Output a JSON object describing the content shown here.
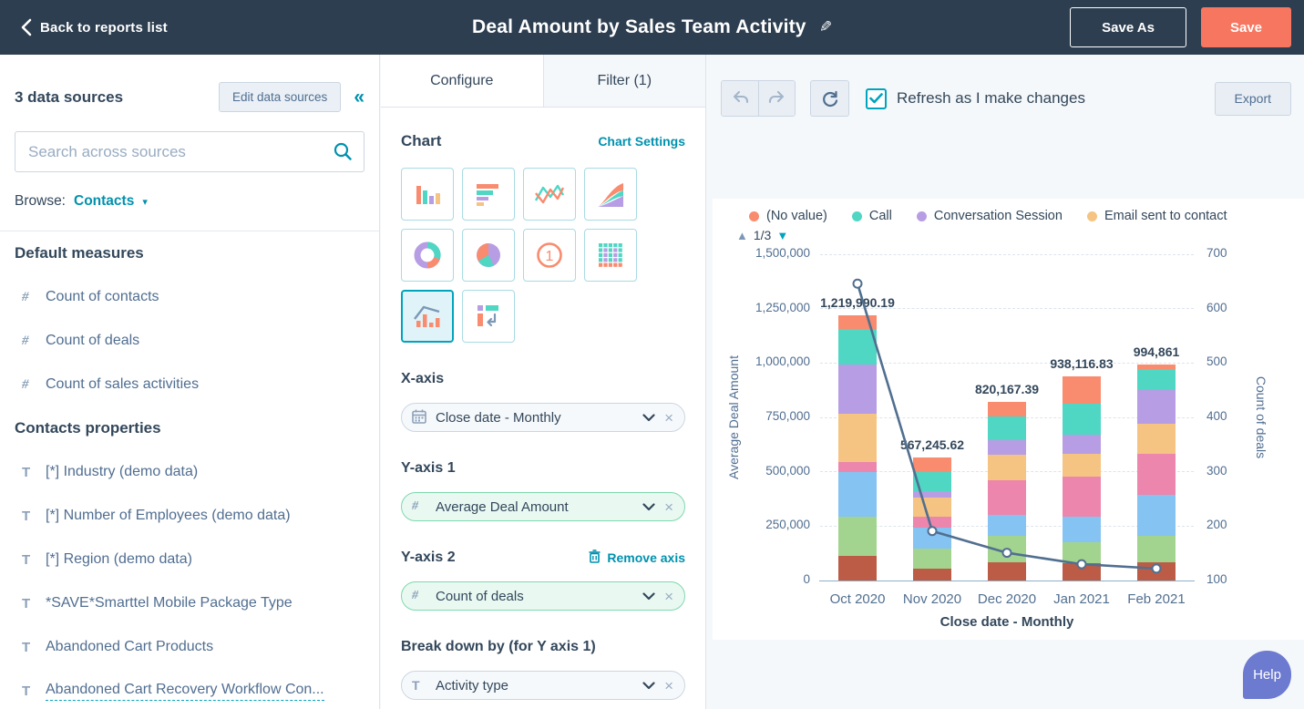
{
  "header": {
    "back_label": "Back to reports list",
    "title": "Deal Amount by Sales Team Activity",
    "save_as_label": "Save As",
    "save_label": "Save"
  },
  "sidebar": {
    "heading": "3 data sources",
    "edit_button": "Edit data sources",
    "collapse_icon": "double-chevron-left",
    "search_placeholder": "Search across sources",
    "browse_label": "Browse:",
    "browse_value": "Contacts",
    "sections": [
      {
        "title": "Default measures",
        "items": [
          {
            "icon": "#",
            "label": "Count of contacts"
          },
          {
            "icon": "#",
            "label": "Count of deals"
          },
          {
            "icon": "#",
            "label": "Count of sales activities"
          }
        ]
      },
      {
        "title": "Contacts properties",
        "items": [
          {
            "icon": "T",
            "label": "[*] Industry (demo data)"
          },
          {
            "icon": "T",
            "label": "[*] Number of Employees (demo data)"
          },
          {
            "icon": "T",
            "label": "[*] Region (demo data)"
          },
          {
            "icon": "T",
            "label": "*SAVE*Smarttel Mobile Package Type"
          },
          {
            "icon": "T",
            "label": "Abandoned Cart Products"
          },
          {
            "icon": "T",
            "label": "Abandoned Cart Recovery Workflow Con...",
            "truncated": true
          }
        ]
      }
    ]
  },
  "configure": {
    "tabs": [
      {
        "label": "Configure",
        "active": true
      },
      {
        "label": "Filter (1)",
        "active": false
      }
    ],
    "chart_heading": "Chart",
    "chart_settings_link": "Chart Settings",
    "chart_types": [
      "column",
      "bar",
      "line",
      "area",
      "donut",
      "pie",
      "summary",
      "table",
      "combo",
      "pivot"
    ],
    "selected_chart_type": "combo",
    "x_axis": {
      "label": "X-axis",
      "pill_icon": "calendar-icon",
      "pill_text": "Close date - Monthly"
    },
    "y_axis_1": {
      "label": "Y-axis 1",
      "pill_icon": "#",
      "pill_text": "Average Deal Amount"
    },
    "y_axis_2": {
      "label": "Y-axis 2",
      "remove_label": "Remove axis",
      "pill_icon": "#",
      "pill_text": "Count of deals"
    },
    "breakdown": {
      "label": "Break down by (for Y axis 1)",
      "pill_icon": "T",
      "pill_text": "Activity type"
    }
  },
  "preview": {
    "refresh_label": "Refresh as I make changes",
    "export_label": "Export",
    "pagination": "1/3",
    "pager_up_icon": "▲",
    "pager_down_icon": "▼",
    "help_label": "Help"
  },
  "chart_data": {
    "type": "combo: stacked column + line",
    "title": "",
    "categories": [
      "Oct 2020",
      "Nov 2020",
      "Dec 2020",
      "Jan 2021",
      "Feb 2021"
    ],
    "bar_series": [
      {
        "name": "",
        "color": "#bd5c46",
        "values": [
          113000,
          55000,
          82000,
          78000,
          82000
        ]
      },
      {
        "name": "",
        "color": "#a3d48f",
        "values": [
          182000,
          90000,
          122000,
          98000,
          122000
        ]
      },
      {
        "name": "",
        "color": "#84c3f2",
        "values": [
          202000,
          100000,
          98000,
          119000,
          188000
        ]
      },
      {
        "name": "",
        "color": "#ec86ad",
        "values": [
          49000,
          50000,
          160000,
          181000,
          189000
        ]
      },
      {
        "name": "Email sent to contact",
        "color": "#f5c482",
        "values": [
          221000,
          85000,
          115000,
          105000,
          140000
        ]
      },
      {
        "name": "Conversation Session",
        "color": "#b79de3",
        "values": [
          226000,
          30000,
          67000,
          91000,
          153000
        ]
      },
      {
        "name": "Call",
        "color": "#4fd7c4",
        "values": [
          163000,
          90000,
          109000,
          139000,
          97000
        ]
      },
      {
        "name": "(No value)",
        "color": "#f98b6f",
        "values": [
          63990.19,
          67245.62,
          67167.39,
          127116.83,
          23861
        ]
      }
    ],
    "bar_totals_labels": [
      "1,219,990.19",
      "567,245.62",
      "820,167.39",
      "938,116.83",
      "994,861"
    ],
    "line_series": {
      "name": "Count of deals",
      "color": "#516f90",
      "values": [
        646,
        191,
        151,
        130,
        122
      ]
    },
    "legend": [
      {
        "label": "(No value)",
        "color": "#f98b6f"
      },
      {
        "label": "Call",
        "color": "#4fd7c4"
      },
      {
        "label": "Conversation Session",
        "color": "#b79de3"
      },
      {
        "label": "Email sent to contact",
        "color": "#f5c482"
      }
    ],
    "legend_position": "top-left",
    "grid": "dashed horizontal",
    "y1": {
      "title": "Average Deal Amount",
      "min": 0,
      "max": 1500000,
      "ticks": [
        "0",
        "250,000",
        "500,000",
        "750,000",
        "1,000,000",
        "1,250,000",
        "1,500,000"
      ]
    },
    "y2": {
      "title": "Count of deals",
      "min": 100,
      "max": 700,
      "ticks": [
        "100",
        "200",
        "300",
        "400",
        "500",
        "600",
        "700"
      ]
    },
    "x_title": "Close date - Monthly"
  }
}
